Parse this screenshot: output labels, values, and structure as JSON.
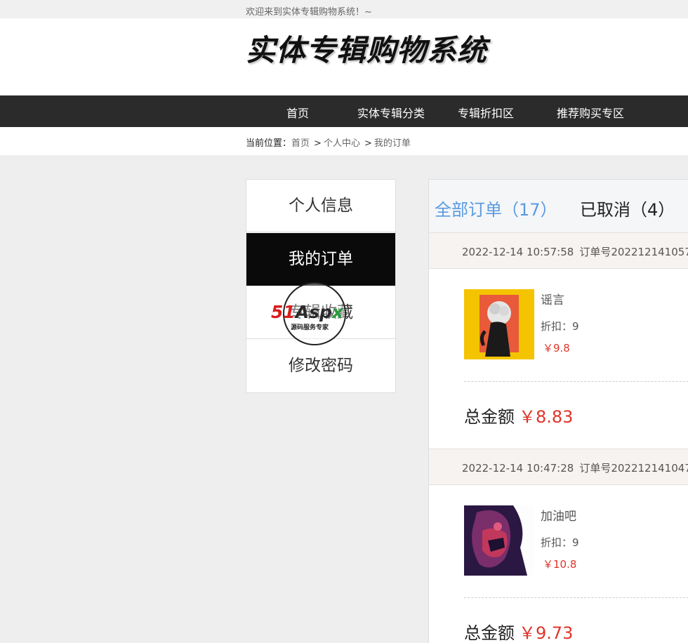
{
  "topbar": {
    "welcome": "欢迎来到实体专辑购物系统！~"
  },
  "header": {
    "site_title": "实体专辑购物系统"
  },
  "nav": {
    "items": [
      "首页",
      "实体专辑分类",
      "专辑折扣区",
      "推荐购买专区"
    ]
  },
  "breadcrumb": {
    "label": "当前位置：",
    "items": [
      "首页",
      "个人中心",
      "我的订单"
    ],
    "separator": ">"
  },
  "sidebar": {
    "items": [
      "个人信息",
      "我的订单",
      "专辑收藏",
      "修改密码"
    ],
    "active_index": 1
  },
  "watermark": {
    "brand_51": "51",
    "brand_aspx": "Asp",
    "brand_x": "x",
    "tagline": "源码服务专家"
  },
  "orders": {
    "tabs": [
      {
        "label": "全部订单（17）"
      },
      {
        "label": "已取消（4）"
      }
    ],
    "list": [
      {
        "datetime": "2022-12-14 10:57:58",
        "order_no": "订单号202212141057",
        "item_name": "谣言",
        "discount": "折扣：9",
        "price": "￥9.8",
        "total_label": "总金额",
        "total": "￥8.83"
      },
      {
        "datetime": "2022-12-14 10:47:28",
        "order_no": "订单号202212141047",
        "item_name": "加油吧",
        "discount": "折扣：9",
        "price": "￥10.8",
        "total_label": "总金额",
        "total": "￥9.73"
      }
    ]
  },
  "colors": {
    "accent": "#5a9ae0",
    "price": "#e0352b",
    "nav_bg": "#2b2b2b",
    "active_menu_bg": "#0a0a0a"
  }
}
